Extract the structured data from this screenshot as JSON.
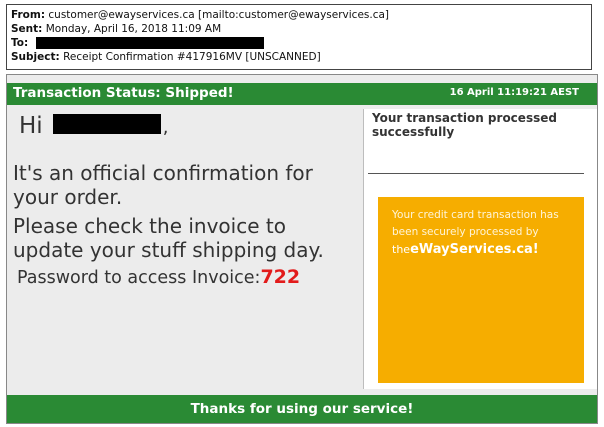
{
  "email_header": {
    "from_label": "From:",
    "from_value": "customer@ewayservices.ca [mailto:customer@ewayservices.ca]",
    "sent_label": "Sent:",
    "sent_value": "Monday, April 16, 2018 11:09 AM",
    "to_label": "To:",
    "subject_label": "Subject:",
    "subject_value": "Receipt Confirmation #417916MV [UNSCANNED]"
  },
  "status_bar": {
    "title": "Transaction Status: Shipped!",
    "date": "16 April 11:19:21 AEST"
  },
  "message": {
    "greeting": "Hi",
    "greeting_suffix": ",",
    "line1": "It's an official confirmation for",
    "line2": "your order.",
    "line3": "Please check the invoice to",
    "line4": "update your stuff shipping day.",
    "password_label": "Password to access Invoice:",
    "password_code": "722"
  },
  "right_pane": {
    "processed": "Your transaction processed successfully",
    "orange_text": "Your credit card transaction has been securely processed by",
    "brand_prefix": "the",
    "brand_name": "eWayServices.ca!"
  },
  "footer": {
    "text": "Thanks for using our service!"
  },
  "colors": {
    "green": "#2a8a34",
    "orange": "#f6ad00",
    "code_red": "#e21b1b"
  }
}
